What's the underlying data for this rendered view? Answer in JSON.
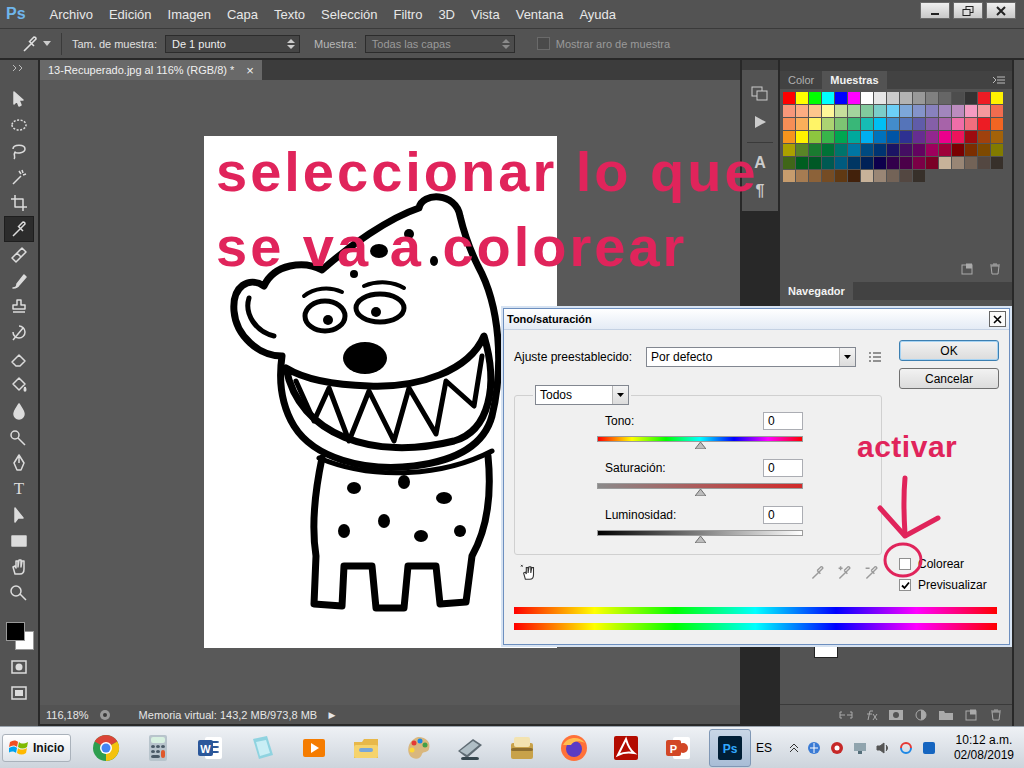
{
  "app": {
    "logo": "Ps"
  },
  "menu": [
    "Archivo",
    "Edición",
    "Imagen",
    "Capa",
    "Texto",
    "Selección",
    "Filtro",
    "3D",
    "Vista",
    "Ventana",
    "Ayuda"
  ],
  "options_bar": {
    "sample_size_label": "Tam. de muestra:",
    "sample_size": "De 1 punto",
    "sample_label": "Muestra:",
    "sample": "Todas las capas",
    "sample_disabled": true,
    "ring_label": "Mostrar aro de muestra",
    "ring_checked": false,
    "ring_disabled": true
  },
  "toolbar": {
    "tools": [
      {
        "selected": false
      },
      {
        "selected": false
      },
      {
        "selected": false
      },
      {
        "selected": false
      },
      {
        "selected": false
      },
      {
        "selected": true
      },
      {
        "selected": false
      },
      {
        "selected": false
      },
      {
        "selected": false
      },
      {
        "selected": false
      },
      {
        "selected": false
      },
      {
        "selected": false
      },
      {
        "selected": false
      },
      {
        "selected": false
      },
      {
        "selected": false
      },
      {
        "selected": false,
        "glyph": "T"
      },
      {
        "selected": false
      },
      {
        "selected": false
      },
      {
        "selected": false
      },
      {
        "selected": false
      }
    ],
    "foreground": "#000000",
    "background": "#ffffff"
  },
  "document": {
    "tab": "13-Recuperado.jpg al 116% (RGB/8) *",
    "close": "×"
  },
  "status_bar": {
    "zoom": "116,18%",
    "memory": "Memoria virtual: 143,2 MB/973,8 MB",
    "menu_arrow": "▶"
  },
  "dock": {
    "glyphs": [
      "A",
      "¶"
    ]
  },
  "panels": {
    "tabs": [
      {
        "label": "Color",
        "selected": false
      },
      {
        "label": "Muestras",
        "selected": true
      }
    ],
    "swatches": [
      "#ff0000",
      "#ffff00",
      "#00ff00",
      "#00ffff",
      "#0000ff",
      "#ff00ff",
      "#ffffff",
      "#e6e6e6",
      "#cccccc",
      "#b3b3b3",
      "#999999",
      "#808080",
      "#666666",
      "#4d4d4d",
      "#333333",
      "#ed1c24",
      "#fff200",
      "#f7977a",
      "#fbad82",
      "#fdc68c",
      "#fff799",
      "#c6df9c",
      "#a4d49d",
      "#81ca9d",
      "#7bcdc9",
      "#6ccff7",
      "#7da7d9",
      "#8493ca",
      "#8881be",
      "#a286bd",
      "#bc8cbf",
      "#f49bc1",
      "#f5999d",
      "#f26c4f",
      "#f68e56",
      "#fbaf5a",
      "#fff467",
      "#acd372",
      "#7dc473",
      "#39b778",
      "#16bcb4",
      "#00bff3",
      "#438ccb",
      "#5574b9",
      "#605ca9",
      "#855fa8",
      "#a763a9",
      "#ef6ea8",
      "#f16d7e",
      "#ed1c24",
      "#f26522",
      "#f7941d",
      "#fff200",
      "#8dc63f",
      "#39b54a",
      "#00a651",
      "#00a99d",
      "#00aeef",
      "#0072bc",
      "#0054a5",
      "#2e3192",
      "#662d91",
      "#92278f",
      "#ec008c",
      "#ed145b",
      "#9e0b0f",
      "#a0410d",
      "#a36209",
      "#aba000",
      "#598527",
      "#1a7b30",
      "#007236",
      "#00746b",
      "#0076a3",
      "#004a80",
      "#003471",
      "#1b1464",
      "#440e62",
      "#630460",
      "#9e005d",
      "#9e0039",
      "#790000",
      "#7b2e00",
      "#7d4900",
      "#827b00",
      "#406618",
      "#005e20",
      "#005826",
      "#005952",
      "#005b7f",
      "#003663",
      "#002157",
      "#0d004c",
      "#32004b",
      "#4b0049",
      "#7b0046",
      "#7a0026",
      "#c7b299",
      "#998675",
      "#736357",
      "#534741",
      "#37302a",
      "#c69c6d",
      "#a67c52",
      "#8c6239",
      "#754c24",
      "#603913",
      "#42210b",
      "#c7b299",
      "#998675",
      "#736357",
      "#534741",
      "#37302a"
    ],
    "navigator_tabs": [
      {
        "label": "Navegador",
        "selected": true
      }
    ]
  },
  "annotations": {
    "heading": [
      "seleccionar lo que",
      "se va a colorear"
    ],
    "activate": "activar"
  },
  "dialog": {
    "title": "Tono/saturación",
    "preset_label": "Ajuste preestablecido:",
    "preset": "Por defecto",
    "channel": "Todos",
    "buttons": [
      {
        "label": "OK",
        "default": true
      },
      {
        "label": "Cancelar",
        "default": false
      }
    ],
    "sliders": [
      {
        "label": "Tono:",
        "value": "0",
        "level": 0.5,
        "kind": "hue"
      },
      {
        "label": "Saturación:",
        "value": "0",
        "level": 0.5,
        "kind": "saturation"
      },
      {
        "label": "Luminosidad:",
        "value": "0",
        "level": 0.5,
        "kind": "lightness"
      }
    ],
    "checkboxes": [
      {
        "label": "Colorear",
        "checked": false
      },
      {
        "label": "Previsualizar",
        "checked": true
      }
    ],
    "eyedroppers_disabled": true
  },
  "taskbar": {
    "start": "Inicio",
    "apps": [
      {
        "selected": false
      },
      {
        "selected": false
      },
      {
        "selected": false,
        "glyph": "W"
      },
      {
        "selected": false
      },
      {
        "selected": false
      },
      {
        "selected": false
      },
      {
        "selected": false
      },
      {
        "selected": false
      },
      {
        "selected": false
      },
      {
        "selected": false
      },
      {
        "selected": false
      },
      {
        "selected": false,
        "glyph": "P"
      },
      {
        "selected": true,
        "glyph": "Ps"
      }
    ],
    "language": "ES",
    "time": "10:12 a.m.",
    "date": "02/08/2019"
  }
}
